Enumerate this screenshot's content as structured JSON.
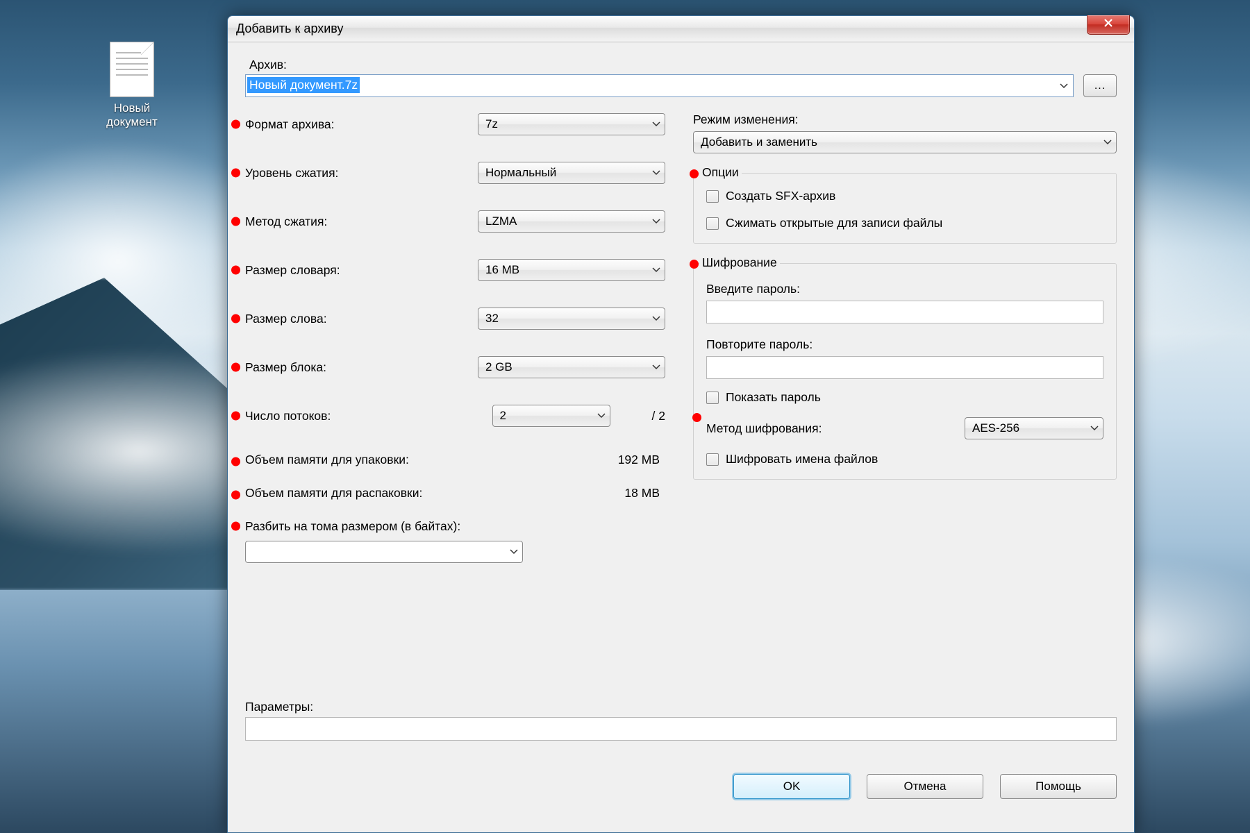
{
  "desktop": {
    "icon_label": "Новый документ"
  },
  "window": {
    "title": "Добавить к архиву"
  },
  "archive": {
    "label": "Архив:",
    "value": "Новый документ.7z",
    "browse_label": "..."
  },
  "left": {
    "format": {
      "label": "Формат архива:",
      "value": "7z"
    },
    "level": {
      "label": "Уровень сжатия:",
      "value": "Нормальный"
    },
    "method": {
      "label": "Метод сжатия:",
      "value": "LZMA"
    },
    "dict": {
      "label": "Размер словаря:",
      "value": "16 MB"
    },
    "word": {
      "label": "Размер слова:",
      "value": "32"
    },
    "block": {
      "label": "Размер блока:",
      "value": "2 GB"
    },
    "threads": {
      "label": "Число потоков:",
      "value": "2",
      "max": "/ 2"
    },
    "mem_pack": {
      "label": "Объем памяти для упаковки:",
      "value": "192 MB"
    },
    "mem_unpack": {
      "label": "Объем памяти для распаковки:",
      "value": "18 MB"
    },
    "split": {
      "label": "Разбить на тома размером (в байтах):",
      "value": ""
    }
  },
  "right": {
    "update": {
      "label": "Режим изменения:",
      "value": "Добавить и заменить"
    },
    "options": {
      "title": "Опции",
      "sfx": "Создать SFX-архив",
      "open_files": "Сжимать открытые для записи файлы"
    },
    "encryption": {
      "title": "Шифрование",
      "enter_pw": "Введите пароль:",
      "repeat_pw": "Повторите пароль:",
      "show_pw": "Показать пароль",
      "method_label": "Метод шифрования:",
      "method_value": "AES-256",
      "encrypt_names": "Шифровать имена файлов"
    }
  },
  "params": {
    "label": "Параметры:",
    "value": ""
  },
  "buttons": {
    "ok": "OK",
    "cancel": "Отмена",
    "help": "Помощь"
  }
}
